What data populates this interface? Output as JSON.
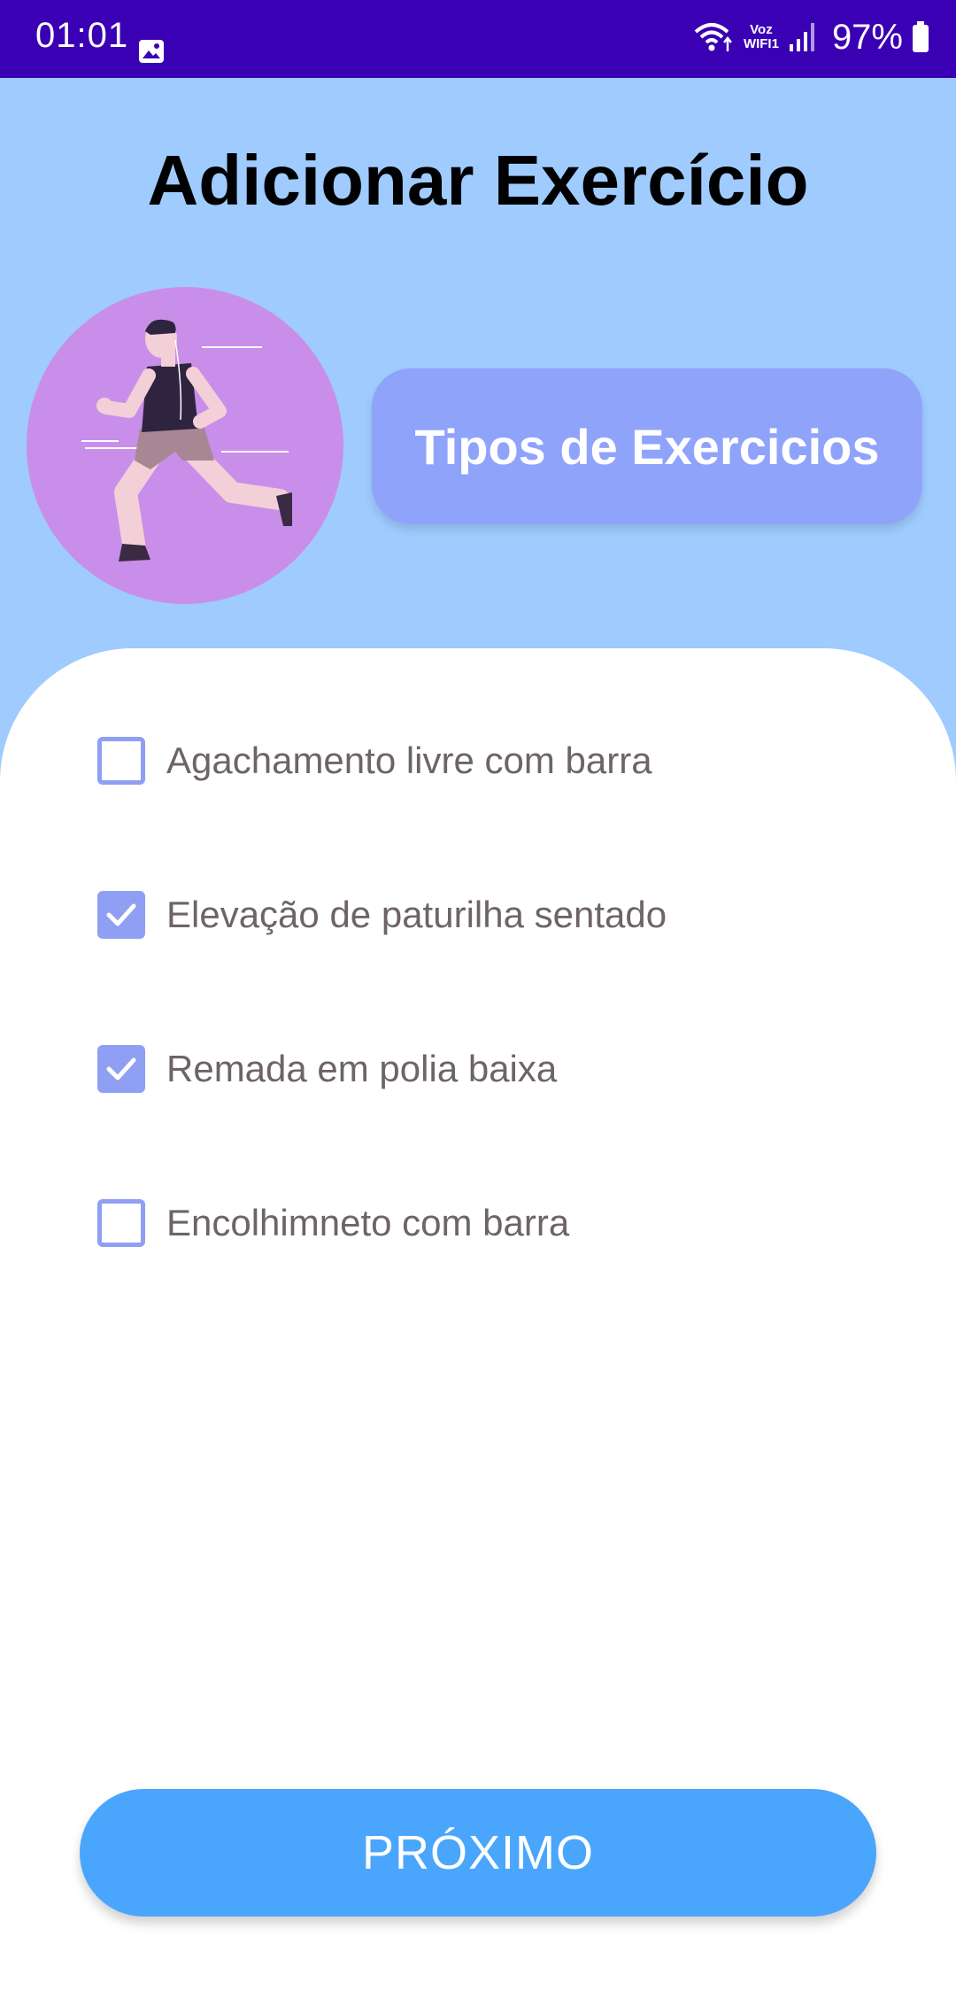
{
  "status_bar": {
    "time": "01:01",
    "carrier_top": "Voz",
    "carrier_bottom": "WIFI1",
    "battery_percent": "97%"
  },
  "header": {
    "title": "Adicionar Exercício"
  },
  "types_button": {
    "label": "Tipos de Exercicios"
  },
  "exercises": [
    {
      "label": "Agachamento livre com barra",
      "checked": false
    },
    {
      "label": "Elevação de paturilha sentado",
      "checked": true
    },
    {
      "label": "Remada em polia baixa",
      "checked": true
    },
    {
      "label": "Encolhimneto com barra",
      "checked": false
    }
  ],
  "next_button": {
    "label": "PRÓXIMO"
  },
  "colors": {
    "status_bar": "#3a00b4",
    "background": "#9fcbfe",
    "accent": "#8f9ff4",
    "primary_button": "#4aa5fc",
    "avatar_bg": "#c98ee9"
  }
}
